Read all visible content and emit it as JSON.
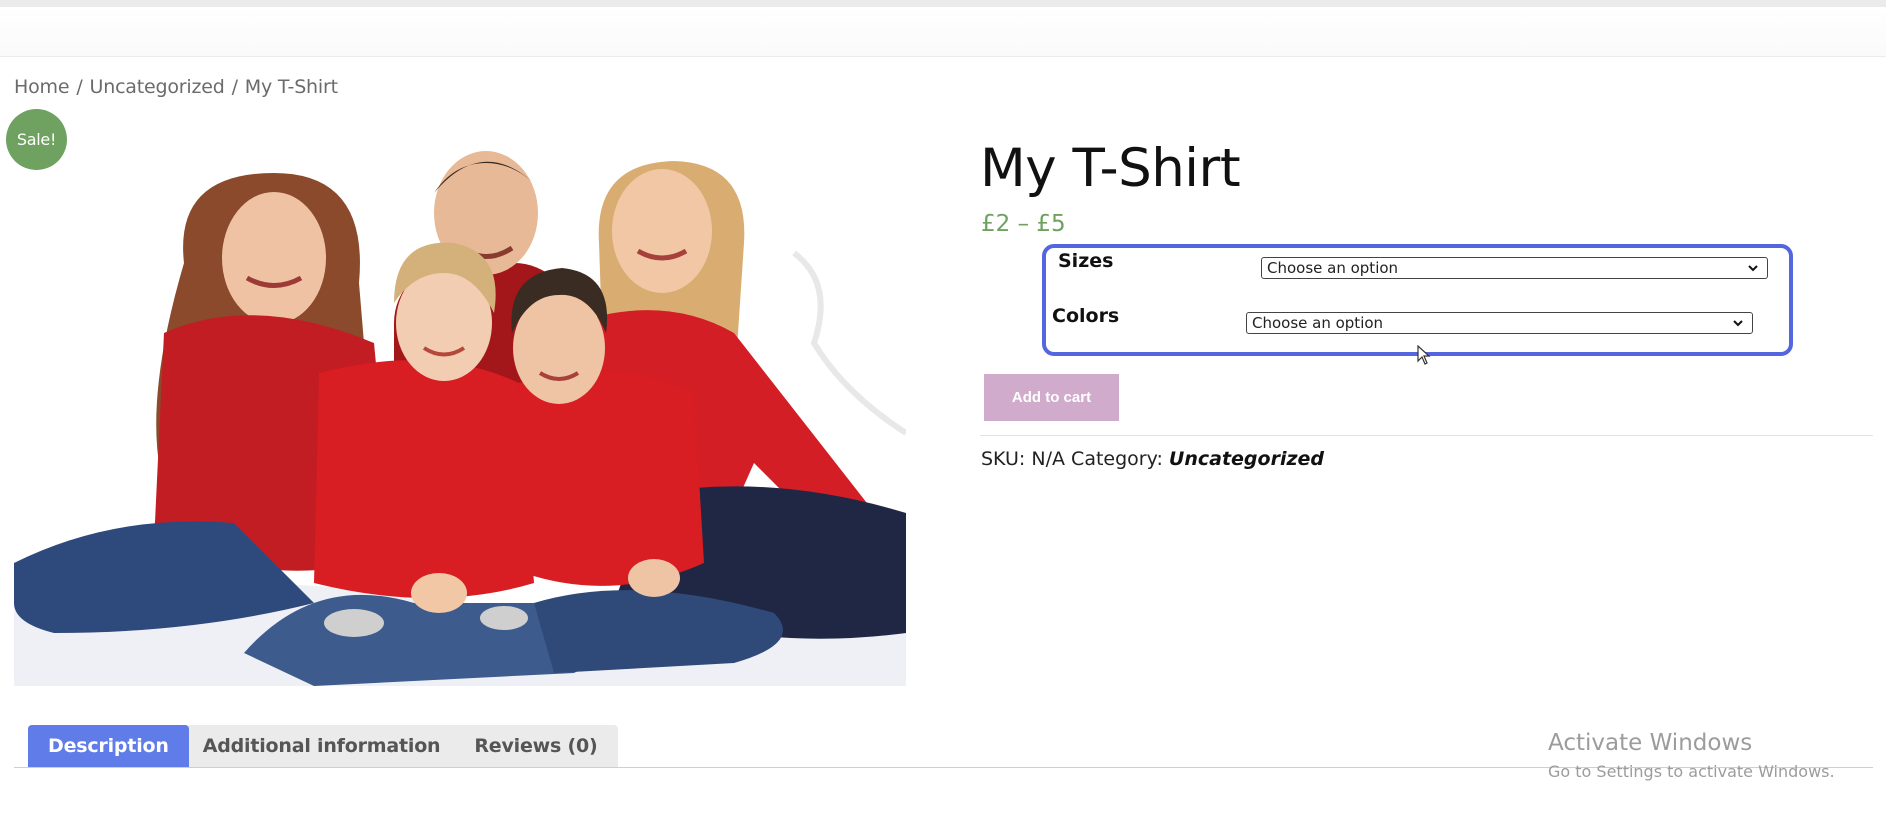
{
  "breadcrumb": {
    "items": [
      "Home",
      "Uncategorized",
      "My T-Shirt"
    ],
    "separator": "/"
  },
  "badge": {
    "label": "Sale!"
  },
  "product": {
    "title": "My T-Shirt",
    "price": "£2 – £5",
    "image_alt": "family in red shirts",
    "variations": {
      "sizes_label": "Sizes",
      "sizes_value": "Choose an option",
      "colors_label": "Colors",
      "colors_value": "Choose an option"
    },
    "add_to_cart_label": "Add to cart",
    "meta": {
      "sku_label": "SKU:",
      "sku_value": "N/A",
      "category_label": "Category:",
      "category_value": "Uncategorized"
    }
  },
  "tabs": [
    {
      "label": "Description",
      "active": true
    },
    {
      "label": "Additional information",
      "active": false
    },
    {
      "label": "Reviews (0)",
      "active": false
    }
  ],
  "watermark": {
    "line1": "Activate Windows",
    "line2": "Go to Settings to activate Windows."
  },
  "colors": {
    "sale_badge": "#6fa161",
    "price": "#6fa161",
    "highlight_box": "#5465e0",
    "add_to_cart_bg": "#d1abcb",
    "active_tab": "#5f7ce9"
  }
}
